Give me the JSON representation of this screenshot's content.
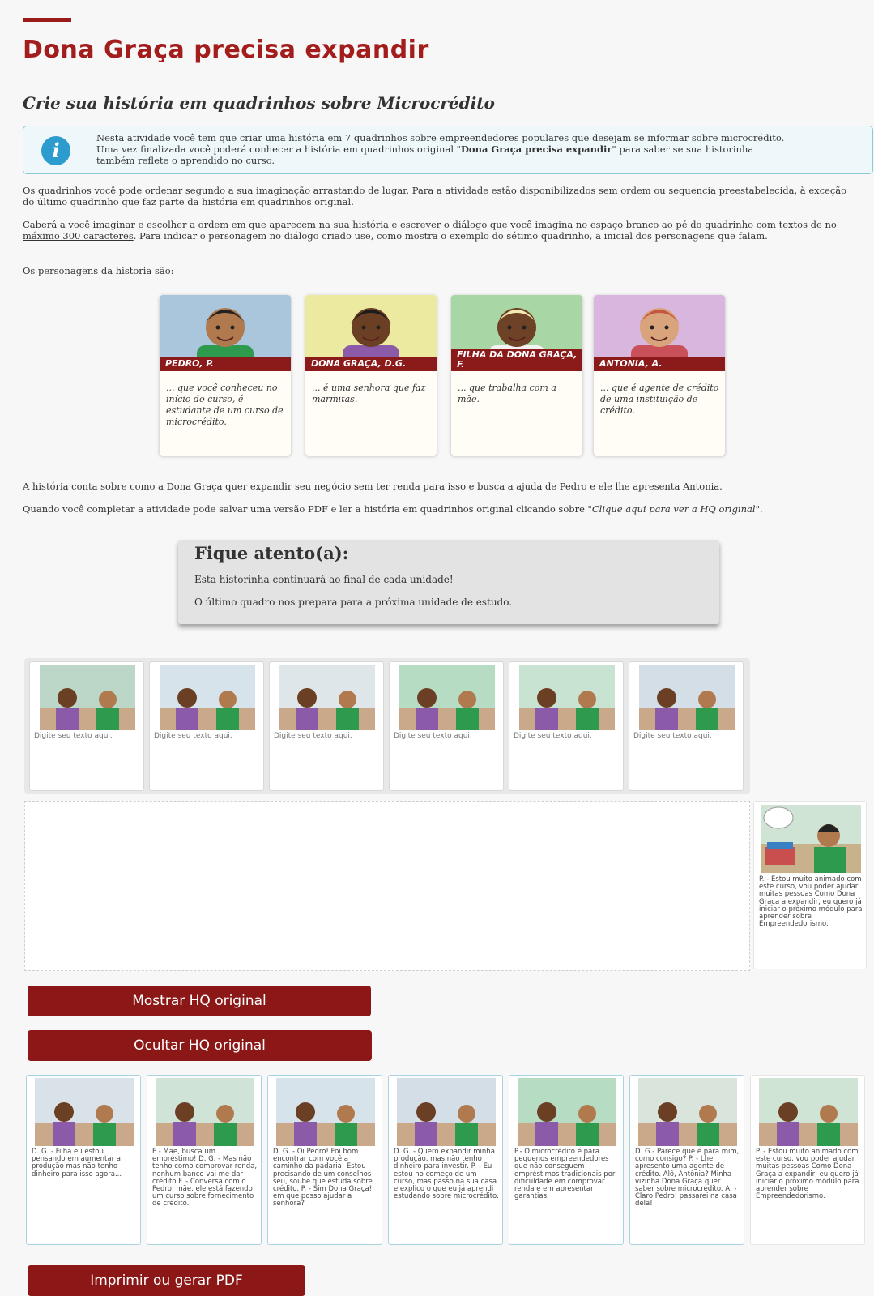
{
  "header": {
    "title": "Dona Graça precisa expandir",
    "subtitle": "Crie sua história em quadrinhos sobre Microcrédito"
  },
  "info": {
    "text_1": "Nesta atividade você tem que criar uma história em 7 quadrinhos sobre empreendedores populares que desejam se informar sobre microcrédito. Uma vez finalizada você poderá conhecer a história em quadrinhos original \"",
    "text_bold": "Dona Graça precisa expandir",
    "text_2": "\" para saber se sua historinha também reflete o aprendido no curso."
  },
  "instructions": {
    "p1": "Os quadrinhos você pode ordenar segundo a sua imaginação arrastando de lugar. Para a atividade estão disponibilizados sem ordem ou sequencia preestabelecida, à exceção do último quadrinho que faz parte da história em quadrinhos original.",
    "p2_a": "Caberá a você imaginar e escolher a ordem em que aparecem na sua história e escrever o diálogo que você imagina no espaço branco ao pé do quadrinho ",
    "p2_u": "com textos de no máximo 300 caracteres",
    "p2_b": ". Para indicar o personagem no diálogo criado use, como mostra o exemplo do sétimo quadrinho, a inicial dos personagens que falam.",
    "p3": "Os personagens da historia são:",
    "p4": "A história conta sobre como a Dona Graça quer expandir seu negócio sem ter renda para isso e busca a ajuda de Pedro e ele lhe apresenta Antonia.",
    "p5_a": "Quando você completar a atividade pode salvar uma versão PDF e ler a história em quadrinhos original clicando sobre \"",
    "p5_i": "Clique aqui para ver a HQ original",
    "p5_b": "\"."
  },
  "characters": [
    {
      "name": "PEDRO, P.",
      "desc": "... que você conheceu no início do curso, é estudante de um curso de microcrédito.",
      "bg": "#a9c6dc",
      "skin": "#b07a4e",
      "hair": "#222222",
      "shirt": "#2e9a4e"
    },
    {
      "name": "DONA GRAÇA, D.G.",
      "desc": "... é uma senhora que faz marmitas.",
      "bg": "#ece9a0",
      "skin": "#6b3f24",
      "hair": "#1c1c1c",
      "shirt": "#8b5aa8"
    },
    {
      "name": "FILHA DA DONA GRAÇA, F.",
      "desc": "... que trabalha com a mãe.",
      "bg": "#a8d6a4",
      "skin": "#6e4226",
      "hair": "#f2ebb0",
      "shirt": "#f3f3f3"
    },
    {
      "name": "ANTONIA, A.",
      "desc": "... que é agente de crédito de uma instituição de crédito.",
      "bg": "#d8b6de",
      "skin": "#d9a37c",
      "hair": "#c4553f",
      "shirt": "#c94f58"
    }
  ],
  "alert": {
    "title": "Fique atento(a):",
    "line1": "Esta historinha continuará ao final de cada unidade!",
    "line2": "O último quadro nos prepara para a próxima unidade de estudo."
  },
  "panels": {
    "placeholder": "Digite seu texto aqui.",
    "scenes": [
      "#bcd7c7",
      "#d7e3ea",
      "#dfe6ea",
      "#b7dcc4",
      "#c9e3d3",
      "#d4dee6"
    ]
  },
  "final_panel": {
    "text": "P. - Estou muito animado com este curso, vou poder ajudar muitas pessoas Como Dona Graça a expandir, eu quero já iniciar o próximo módulo para aprender sobre Empreendedorismo."
  },
  "buttons": {
    "show": "Mostrar HQ original",
    "hide": "Ocultar HQ original",
    "print": "Imprimir ou gerar PDF"
  },
  "original": [
    "D. G. - Filha eu estou pensando em aumentar a produção mas não tenho dinheiro para isso agora...",
    "F - Mãe, busca um empréstimo! D. G. - Mas não tenho como comprovar renda, nenhum banco vai me dar crédito F. - Conversa com o Pedro, mãe, ele está fazendo um curso sobre fornecimento de crédito.",
    "D. G. - Oi Pedro! Foi bom encontrar com você a caminho da padaria! Estou precisando de um conselhos seu, soube que estuda sobre crédito. P. - Sim Dona Graça! em que posso ajudar a senhora?",
    "D. G. - Quero expandir minha produção, mas não tenho dinheiro para investir. P. - Eu estou no começo de um curso, mas passo na sua casa e explico o que eu já aprendi estudando sobre microcrédito.",
    "P.- O microcrédito é para pequenos empreendedores que não conseguem empréstimos tradicionais por dificuldade em comprovar renda e em apresentar garantias.",
    "D. G.- Parece que é para mim, como consigo? P. - Lhe apresento uma agente de crédito. Alô, Antônia? Minha vizinha Dona Graça quer saber sobre microcrédito. A. - Claro Pedro! passarei na casa dela!",
    "P. - Estou muito animado com este curso, vou poder ajudar muitas pessoas Como Dona Graça a expandir, eu quero já iniciar o próximo módulo para aprender sobre Empreendedorismo."
  ],
  "colors": {
    "accent": "#9b1b1b",
    "button": "#8c1717",
    "info_icon": "#2b9ccd"
  }
}
